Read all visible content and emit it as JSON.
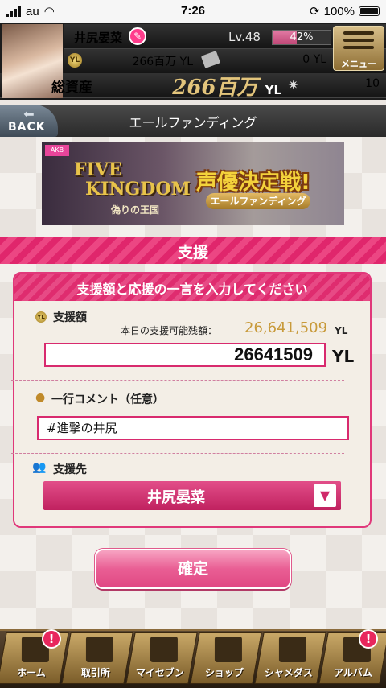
{
  "status_bar": {
    "carrier": "au",
    "time": "7:26",
    "battery": "100%"
  },
  "header": {
    "player_name": "井尻晏菜",
    "level": "Lv.48",
    "level_progress": "42%",
    "level_progress_fraction": 0.42,
    "money": "266百万 YL",
    "tickets": "0 YL",
    "total_assets_label": "総資産",
    "total_assets_value": "266百万",
    "total_assets_unit": "YL",
    "gems": "10",
    "menu_label": "メニュー"
  },
  "nav": {
    "back_label": "BACK",
    "page_title": "エールファンディング"
  },
  "banner": {
    "logo": "AKB",
    "title_line1": "FIVE",
    "title_line2": "KINGDOM",
    "subtitle": "偽りの王国",
    "event_title": "声優決定戦!",
    "event_sub": "エールファンディング"
  },
  "section": {
    "title": "支援"
  },
  "form": {
    "header": "支援額と応援の一言を入力してください",
    "amount_label": "支援額",
    "remaining_label": "本日の支援可能残額：",
    "remaining_value": "26,641,509",
    "remaining_unit": "YL",
    "amount_value": "26641509",
    "amount_unit": "YL",
    "comment_label": "一行コメント（任意）",
    "comment_value": "#進撃の井尻",
    "target_label": "支援先",
    "target_value": "井尻晏菜"
  },
  "confirm_label": "確定",
  "tabs": [
    {
      "label": "ホーム",
      "badge": "!"
    },
    {
      "label": "取引所"
    },
    {
      "label": "マイセブン"
    },
    {
      "label": "ショップ"
    },
    {
      "label": "シャメダス"
    },
    {
      "label": "アルバム",
      "badge": "!"
    }
  ]
}
